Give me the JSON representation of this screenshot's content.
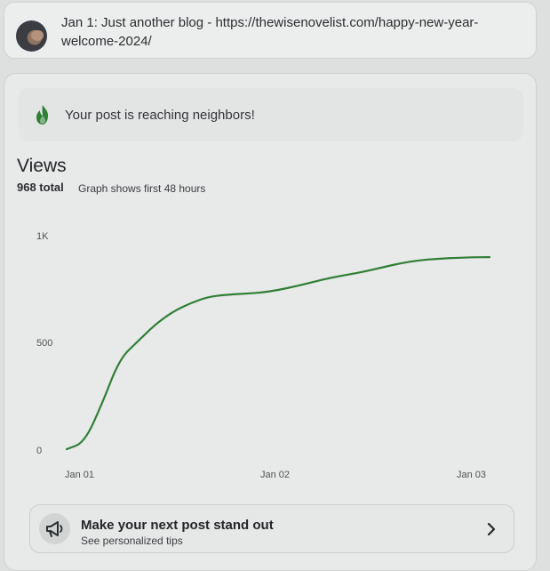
{
  "post": {
    "text": "Jan 1: Just another blog - https://thewisenovelist.com/happy-new-year-welcome-2024/"
  },
  "insights": {
    "reach_message": "Your post is reaching neighbors!",
    "views_title": "Views",
    "views_total": "968 total",
    "views_note": "Graph shows first 48 hours"
  },
  "tip": {
    "title": "Make your next post stand out",
    "subtitle": "See personalized tips"
  },
  "icons": {
    "avatar": "profile-avatar",
    "reach": "flame-icon",
    "tip": "megaphone-icon",
    "navigation": "chevron-right-icon"
  },
  "colors": {
    "accent_green": "#2f7f34",
    "chart_line": "#2f7f34"
  },
  "chart_data": {
    "type": "line",
    "title": "",
    "xlabel": "",
    "ylabel": "",
    "ylim": [
      0,
      1000
    ],
    "yticks": [
      "0",
      "500",
      "1K"
    ],
    "xticks": [
      "Jan 01",
      "Jan 02",
      "Jan 03"
    ],
    "series": [
      {
        "values": [
          {
            "x": 0,
            "y": 0
          },
          {
            "x": 2,
            "y": 30
          },
          {
            "x": 4,
            "y": 210
          },
          {
            "x": 6,
            "y": 420
          },
          {
            "x": 8,
            "y": 500
          },
          {
            "x": 10,
            "y": 580
          },
          {
            "x": 12,
            "y": 640
          },
          {
            "x": 14,
            "y": 680
          },
          {
            "x": 16,
            "y": 710
          },
          {
            "x": 18,
            "y": 720
          },
          {
            "x": 20,
            "y": 725
          },
          {
            "x": 22,
            "y": 730
          },
          {
            "x": 24,
            "y": 742
          },
          {
            "x": 26,
            "y": 760
          },
          {
            "x": 28,
            "y": 780
          },
          {
            "x": 30,
            "y": 800
          },
          {
            "x": 32,
            "y": 815
          },
          {
            "x": 34,
            "y": 830
          },
          {
            "x": 36,
            "y": 850
          },
          {
            "x": 38,
            "y": 868
          },
          {
            "x": 40,
            "y": 881
          },
          {
            "x": 42,
            "y": 888
          },
          {
            "x": 44,
            "y": 892
          },
          {
            "x": 46,
            "y": 895
          },
          {
            "x": 48,
            "y": 896
          }
        ]
      }
    ]
  }
}
